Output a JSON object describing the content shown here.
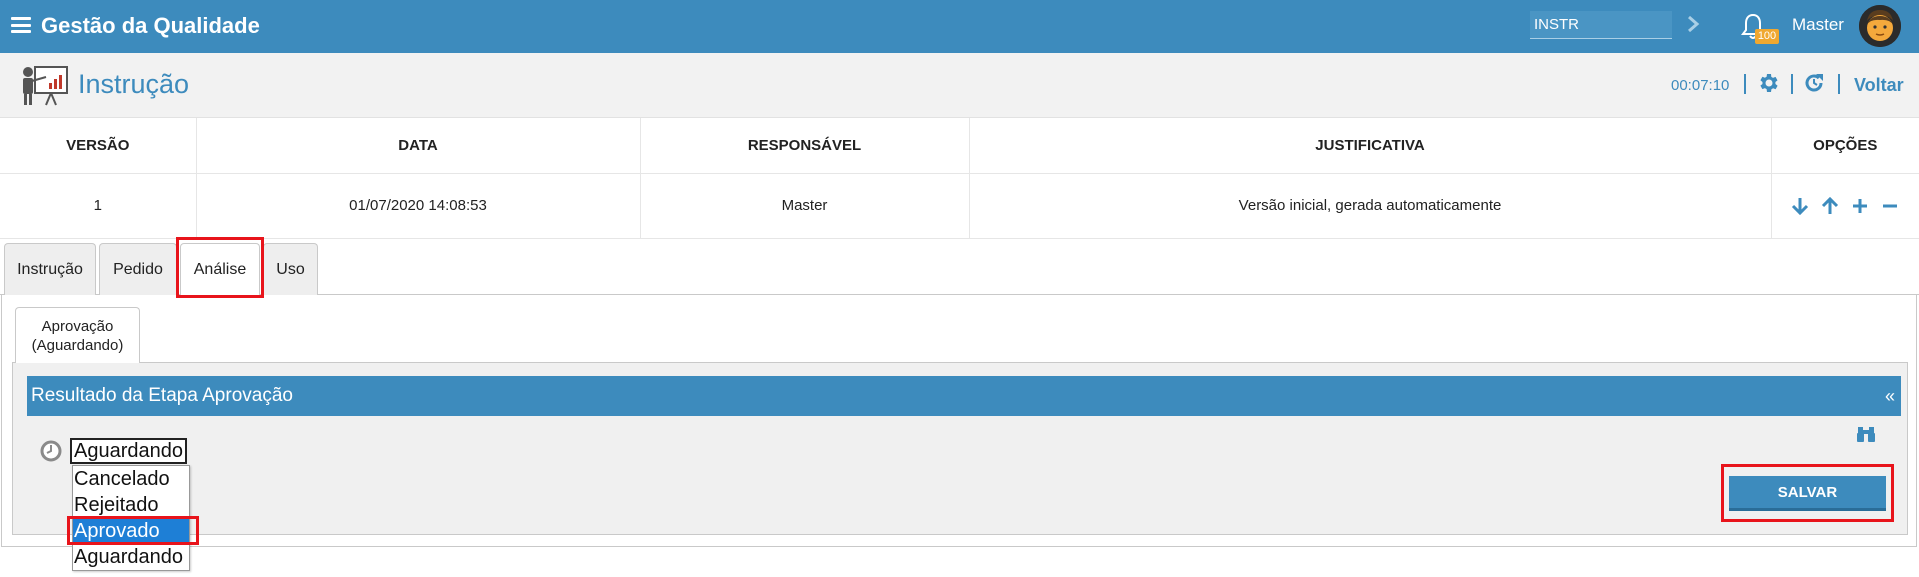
{
  "topbar": {
    "menu_icon": "hamburger-menu-icon",
    "title": "Gestão da Qualidade",
    "search_value": "INSTR",
    "notifications_count": "100",
    "user_name": "Master"
  },
  "page_header": {
    "title": "Instrução",
    "timer": "00:07:10",
    "back_label": "Voltar"
  },
  "versions_table": {
    "columns": [
      "VERSÃO",
      "DATA",
      "RESPONSÁVEL",
      "JUSTIFICATIVA",
      "OPÇÕES"
    ],
    "rows": [
      {
        "version": "1",
        "date": "01/07/2020 14:08:53",
        "responsible": "Master",
        "justification": "Versão inicial, gerada automaticamente"
      }
    ]
  },
  "tabs": [
    "Instrução",
    "Pedido",
    "Análise",
    "Uso"
  ],
  "active_tab": "Análise",
  "subtab": {
    "line1": "Aprovação",
    "line2": "(Aguardando)"
  },
  "section": {
    "title": "Resultado da Etapa Aprovação",
    "collapse_glyph": "«"
  },
  "status_select": {
    "value": "Aguardando",
    "options": [
      "Cancelado",
      "Rejeitado",
      "Aprovado",
      "Aguardando"
    ],
    "highlighted_option": "Aprovado"
  },
  "save_button": "SALVAR",
  "colors": {
    "primary": "#3d8bbd",
    "highlight_box": "#e8141b",
    "badge": "#f0a830",
    "selected_option": "#1e7fd6"
  }
}
